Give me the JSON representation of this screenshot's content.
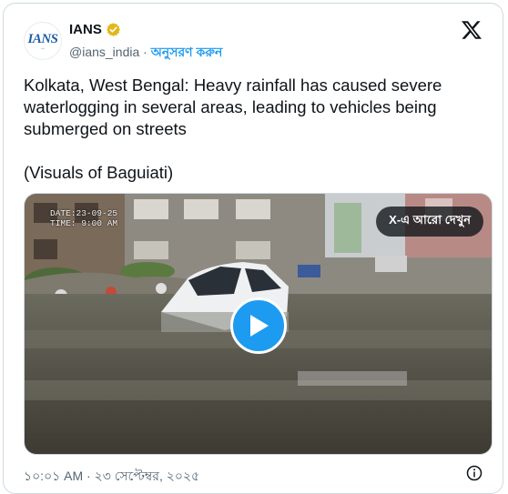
{
  "account": {
    "name": "IANS",
    "handle": "@ians_india",
    "separator": " · ",
    "follow_label": "অনুসরণ করুন",
    "avatar_logo": "IANS",
    "verified_icon": "verified-badge-icon"
  },
  "tweet": {
    "text": "Kolkata, West Bengal: Heavy rainfall has caused severe waterlogging in several areas, leading to vehicles being submerged on streets\n\n(Visuals of Baguiati)"
  },
  "media": {
    "date_overlay": "DATE:23-09-25",
    "time_overlay": "TIME:  9:00 AM",
    "see_more_label": "X-এ আরো দেখুন",
    "play_icon": "play-icon"
  },
  "footer": {
    "timestamp": "১০:০১ AM · ২৩ সেপ্টেম্বর, ২০২৫",
    "info_icon": "info-icon"
  },
  "colors": {
    "accent": "#1d9bf0",
    "verified_gold": "#e2b719",
    "text": "#0f1419",
    "secondary": "#536471"
  }
}
